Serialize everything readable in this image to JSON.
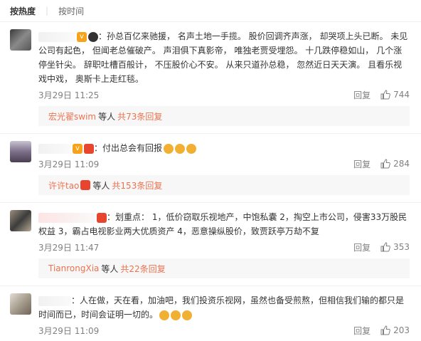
{
  "tabs": {
    "hot": "按热度",
    "time": "按时间",
    "sep": "|"
  },
  "comments": [
    {
      "text": "：孙总百亿来驰援， 名声土地一手揽。 股价回调齐声涨， 却哭项上头已断。 未见公司有起色， 但闻老总催破产。 声泪俱下真影帝， 唯独老贾受埋怨。 十几跌停稳如山， 几个涨停坐针尖。 辞职吐槽百般计， 不压股价心不安。 从来只道孙总稳， 忽然近日天天演。 且看乐视戏中戏， 奥斯卡上走红毯。",
      "time": "3月29日 11:25",
      "reply": "回复",
      "likes": "744",
      "sub": {
        "user": "宏光翟swim",
        "mid": "等人",
        "count": "共73条回复"
      }
    },
    {
      "text": "：付出总会有回报",
      "time": "3月29日 11:09",
      "reply": "回复",
      "likes": "284",
      "sub": {
        "user": "许许tao",
        "mid": "等人",
        "count": "共153条回复"
      }
    },
    {
      "text": "：划重点： 1，低价窃取乐视地产，中饱私囊 2，掏空上市公司，侵害33万股民权益 3，霸占电视影业两大优质资产 4，恶意操纵股价，致贾跃亭万劫不复",
      "time": "3月29日 11:47",
      "reply": "回复",
      "likes": "353",
      "sub": {
        "user": "TianrongXia",
        "mid": "等人",
        "count": "共22条回复"
      }
    },
    {
      "text": "：人在做，天在看，加油吧，我们投资乐视网，虽然也备受煎熬，但相信我们输的都只是时间而已，时间会证明一切的。",
      "time": "3月29日 11:09",
      "reply": "回复",
      "likes": "203"
    }
  ],
  "icons": {
    "like": "thumbs-up-icon",
    "vip": "vip-badge-icon",
    "emoji": "emoji-icon"
  },
  "colors": {
    "link": "#eb7350",
    "meta": "#808080",
    "text": "#333333",
    "subbg": "#f7f7f7"
  }
}
